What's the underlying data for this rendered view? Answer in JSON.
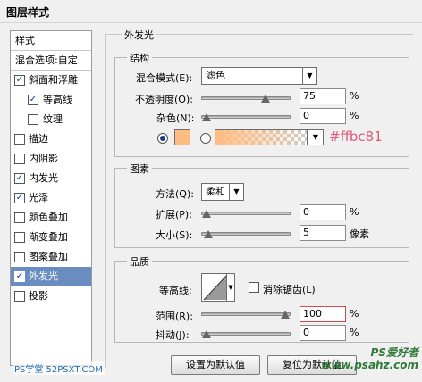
{
  "window": {
    "title": "图层样式"
  },
  "styles_list": {
    "header": "样式",
    "blend_options": "混合选项:自定",
    "items": [
      {
        "label": "斜面和浮雕",
        "checked": true
      },
      {
        "label": "等高线",
        "checked": true
      },
      {
        "label": "纹理",
        "checked": false
      },
      {
        "label": "描边",
        "checked": false
      },
      {
        "label": "内阴影",
        "checked": false
      },
      {
        "label": "内发光",
        "checked": true
      },
      {
        "label": "光泽",
        "checked": true
      },
      {
        "label": "颜色叠加",
        "checked": false
      },
      {
        "label": "渐变叠加",
        "checked": false
      },
      {
        "label": "图案叠加",
        "checked": false
      },
      {
        "label": "外发光",
        "checked": true
      },
      {
        "label": "投影",
        "checked": false
      }
    ],
    "check_mark": "✓"
  },
  "outer_glow": {
    "title": "外发光",
    "structure": {
      "title": "结构",
      "blend_mode_label": "混合模式(E):",
      "blend_mode_value": "滤色",
      "opacity_label": "不透明度(O):",
      "opacity_value": "75",
      "opacity_fraction": 0.75,
      "noise_label": "杂色(N):",
      "noise_value": "0",
      "noise_fraction": 0,
      "percent": "%",
      "color": "#ffbc81",
      "color_annotation": "#ffbc81"
    },
    "elements": {
      "title": "图素",
      "technique_label": "方法(Q):",
      "technique_value": "柔和",
      "spread_label": "扩展(P):",
      "spread_value": "0",
      "spread_fraction": 0,
      "size_label": "大小(S):",
      "size_value": "5",
      "size_unit": "像素",
      "size_fraction": 0.02,
      "percent": "%"
    },
    "quality": {
      "title": "品质",
      "contour_label": "等高线:",
      "antialias_label": "消除锯齿(L)",
      "range_label": "范围(R):",
      "range_value": "100",
      "range_fraction": 1.0,
      "jitter_label": "抖动(J):",
      "jitter_value": "0",
      "jitter_fraction": 0,
      "percent": "%"
    },
    "buttons": {
      "set_default": "设置为默认值",
      "reset_default": "复位为默认值"
    }
  },
  "watermarks": {
    "bottom_left": "PS学堂 52PSXT.COM",
    "bottom_right": "PS爱好者 www.psahz.com"
  }
}
